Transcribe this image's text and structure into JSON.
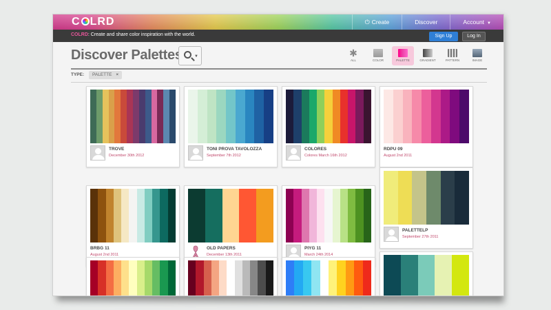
{
  "brand": {
    "logo_prefix": "C",
    "logo_suffix": "LRD"
  },
  "nav": {
    "create": "Create",
    "discover": "Discover",
    "account": "Account"
  },
  "subbar": {
    "brand": "COLRD",
    "tagline": ": Create and share color inspiration with the world.",
    "signup": "Sign Up",
    "login": "Log In"
  },
  "page": {
    "title": "Discover Palettes",
    "filter_label": "TYPE:",
    "filter_chip": "PALETTE",
    "filter_remove": "×"
  },
  "types": [
    {
      "label": "ALL",
      "icon": "star-icon"
    },
    {
      "label": "COLOR",
      "icon": "color-swatch-icon"
    },
    {
      "label": "PALETTE",
      "icon": "palette-icon",
      "active": true
    },
    {
      "label": "GRADIENT",
      "icon": "gradient-icon"
    },
    {
      "label": "PATTERN",
      "icon": "pattern-icon"
    },
    {
      "label": "IMAGE",
      "icon": "image-icon"
    }
  ],
  "palettes": [
    {
      "name": "TROVE",
      "date": "December 30th 2012",
      "avatar": "default",
      "colors": [
        "#3e6b56",
        "#6d9b6a",
        "#e6c25c",
        "#d9a04a",
        "#e2783c",
        "#c94a3a",
        "#a93555",
        "#7c3a6b",
        "#4a3b6e",
        "#3d5a8a",
        "#d868a0",
        "#7a2a56",
        "#5c88b0",
        "#2a4a6c"
      ]
    },
    {
      "name": "TONI PROVA TAVOLOZZA",
      "date": "September 7th 2012",
      "avatar": "default",
      "colors": [
        "#eaf5ea",
        "#d4eed6",
        "#bfe4c4",
        "#9bd7c0",
        "#73c6c9",
        "#4aa8d0",
        "#2a86c0",
        "#1f62a4",
        "#173f85"
      ]
    },
    {
      "name": "COLORES",
      "date": "Colores March 16th 2012",
      "avatar": "default",
      "colors": [
        "#1c1b3a",
        "#1e3f6a",
        "#1b7a5c",
        "#1aa86a",
        "#8ecf5a",
        "#f5d03b",
        "#f08a24",
        "#e8312c",
        "#c8156a",
        "#7a1a5c",
        "#3a1430"
      ]
    },
    {
      "name": "RDPU 09",
      "date": "August 2nd 2011",
      "avatar": "none",
      "colors": [
        "#fde8e5",
        "#fbd0d0",
        "#f9b3bd",
        "#f68aa9",
        "#ec5f9c",
        "#d3378f",
        "#ac1a87",
        "#7f0b7e",
        "#4d0a6a"
      ]
    },
    {
      "name": "BRBG 11",
      "date": "August 2nd 2011",
      "avatar": "none",
      "colors": [
        "#5a3209",
        "#8d520e",
        "#c0832d",
        "#dfc37c",
        "#f5e8c4",
        "#f4f4f2",
        "#c8eae4",
        "#80cdc1",
        "#36968e",
        "#0d6a60",
        "#043d33"
      ]
    },
    {
      "name": "OLD PAPERS",
      "date": "December 13th 2011",
      "avatar": "ribbon",
      "colors": [
        "#0c3b31",
        "#156e5f",
        "#ffd592",
        "#ff5733",
        "#f39c1f"
      ]
    },
    {
      "name": "PIYG 11",
      "date": "March 24th 2014",
      "avatar": "default",
      "colors": [
        "#8e0152",
        "#c51b7d",
        "#de77ae",
        "#f1b6da",
        "#fde0ef",
        "#f7f7f7",
        "#e6f5d0",
        "#b8e186",
        "#7fbc41",
        "#4d9221",
        "#276419"
      ]
    },
    {
      "name": "PALETTELP",
      "date": "September 27th 2011",
      "avatar": "default",
      "colors": [
        "#f0ec7a",
        "#eedd55",
        "#c4c48a",
        "#6e8a6b",
        "#2b3e4a",
        "#192b3a"
      ]
    },
    {
      "name": "",
      "date": "",
      "avatar": "none",
      "colors": [
        "#a50026",
        "#d73027",
        "#f46d43",
        "#fdae61",
        "#fee08b",
        "#ffffbf",
        "#d9ef8b",
        "#a6d96a",
        "#66bd63",
        "#1a9850",
        "#006837"
      ]
    },
    {
      "name": "",
      "date": "",
      "avatar": "none",
      "colors": [
        "#67001f",
        "#b2182b",
        "#d6604d",
        "#f4a582",
        "#fddbc7",
        "#ffffff",
        "#e0e0e0",
        "#bababa",
        "#878787",
        "#4d4d4d",
        "#1a1a1a"
      ]
    },
    {
      "name": "",
      "date": "",
      "avatar": "none",
      "colors": [
        "#2e7df7",
        "#23a9f3",
        "#38c8f0",
        "#8fe5f2",
        "#ffffff",
        "#fff27a",
        "#ffd21f",
        "#ff9a13",
        "#ff5b0f",
        "#ef2a1b"
      ]
    },
    {
      "name": "",
      "date": "",
      "avatar": "none",
      "colors": [
        "#0d4a55",
        "#2a8079",
        "#7bcbb9",
        "#e6f2b3",
        "#d3e70f"
      ]
    }
  ]
}
